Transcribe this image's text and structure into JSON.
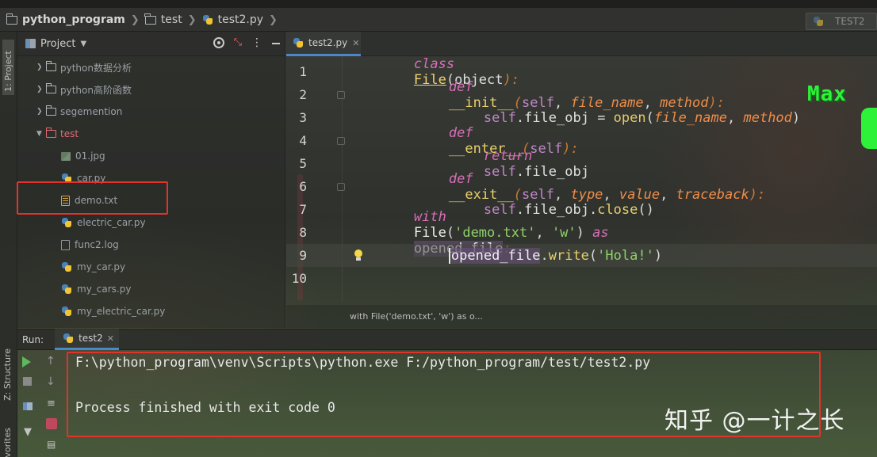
{
  "navbar": {
    "crumbs": [
      "python_program",
      "test",
      "test2.py"
    ],
    "run_config": "TEST2"
  },
  "left_strip": {
    "project_tab": "1: Project",
    "structure_tab": "Z: Structure",
    "favorites_tab": "vorites"
  },
  "project_panel": {
    "title": "Project",
    "items": [
      {
        "label": "python数据分析",
        "kind": "folder",
        "expanded": false
      },
      {
        "label": "python高阶函数",
        "kind": "folder",
        "expanded": false
      },
      {
        "label": "segemention",
        "kind": "folder",
        "expanded": false
      },
      {
        "label": "test",
        "kind": "folder",
        "expanded": true
      },
      {
        "label": "01.jpg",
        "kind": "image"
      },
      {
        "label": "car.py",
        "kind": "python"
      },
      {
        "label": "demo.txt",
        "kind": "text"
      },
      {
        "label": "electric_car.py",
        "kind": "python"
      },
      {
        "label": "func2.log",
        "kind": "log"
      },
      {
        "label": "my_car.py",
        "kind": "python"
      },
      {
        "label": "my_cars.py",
        "kind": "python"
      },
      {
        "label": "my_electric_car.py",
        "kind": "python"
      }
    ]
  },
  "editor": {
    "tab_label": "test2.py",
    "line_numbers": [
      "1",
      "2",
      "3",
      "4",
      "5",
      "6",
      "7",
      "8",
      "9",
      "10"
    ],
    "tokens": {
      "l1": [
        "class",
        "File",
        "(",
        "object",
        "):"
      ],
      "l2": [
        "def",
        "__init__",
        "(",
        "self",
        ", ",
        "file_name",
        ", ",
        "method",
        "):"
      ],
      "l3": [
        "self",
        ".file_obj = ",
        "open",
        "(",
        "file_name",
        ", ",
        "method",
        ")"
      ],
      "l4": [
        "def",
        "__enter__",
        "(",
        "self",
        "):"
      ],
      "l5": [
        "return",
        "self",
        ".file_obj"
      ],
      "l6": [
        "def",
        "__exit__",
        "(",
        "self",
        ", ",
        "type",
        ", ",
        "value",
        ", ",
        "traceback",
        "):"
      ],
      "l7": [
        "self",
        ".file_obj.",
        "close",
        "()"
      ],
      "l8": [
        "with",
        "File",
        "(",
        "'demo.txt'",
        ", ",
        "'w'",
        ") ",
        "as",
        "opened_file",
        ":"
      ],
      "l9": [
        "opened_file",
        ".",
        "write",
        "(",
        "'Hola!'",
        ")"
      ]
    },
    "breadcrumb": "with File('demo.txt', 'w') as o..."
  },
  "run_panel": {
    "label": "Run:",
    "tab_label": "test2",
    "console_lines": [
      "F:\\python_program\\venv\\Scripts\\python.exe F:/python_program/test/test2.py",
      "",
      "Process finished with exit code 0"
    ]
  },
  "overlays": {
    "sticker_text": "Max",
    "watermark": "知乎 @一计之长"
  },
  "colors": {
    "highlight_box": "#e2332b",
    "accent_tab": "#4a88c7",
    "keyword": "#cc7832",
    "string": "#8fd16a"
  }
}
